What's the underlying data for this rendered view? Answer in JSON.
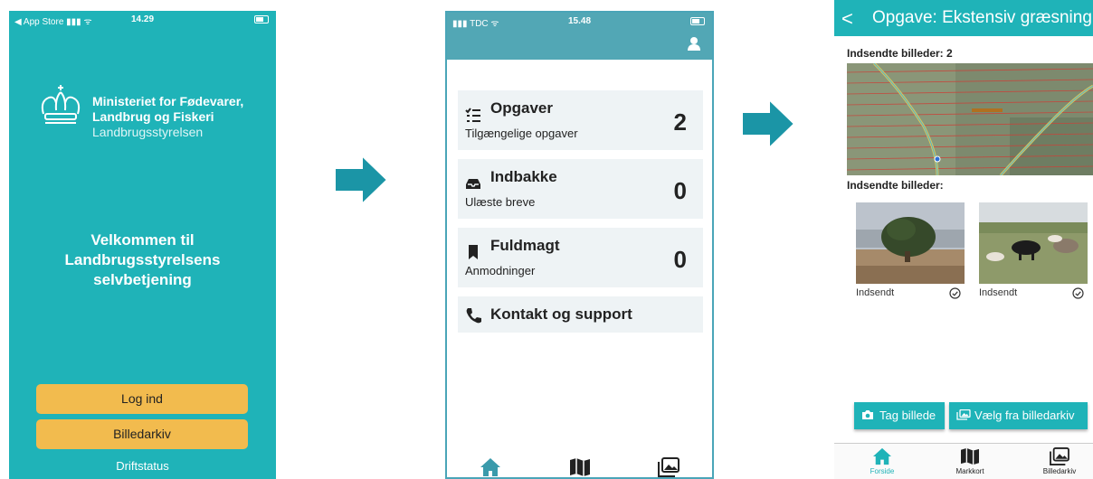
{
  "colors": {
    "teal": "#1fb3b8",
    "teal_header": "#52a7b5",
    "yellow_button": "#f2bb4e",
    "arrow": "#1b95a6",
    "card_bg": "#eef3f5"
  },
  "screen1": {
    "status": {
      "left": "◀ App Store ▮▮▮ ᯤ",
      "time": "14.29"
    },
    "ministry_line1": "Ministeriet for Fødevarer,",
    "ministry_line2": "Landbrug og Fiskeri",
    "ministry_line3": "Landbrugsstyrelsen",
    "welcome_line1": "Velkommen til",
    "welcome_line2": "Landbrugsstyrelsens",
    "welcome_line3": "selvbetjening",
    "login_label": "Log ind",
    "archive_label": "Billedarkiv",
    "status_link": "Driftstatus"
  },
  "screen2": {
    "status": {
      "left": "▮▮▮ TDC ᯤ",
      "time": "15.48"
    },
    "cards": [
      {
        "title": "Opgaver",
        "subtitle": "Tilgængelige opgaver",
        "count": "2",
        "icon": "list-icon"
      },
      {
        "title": "Indbakke",
        "subtitle": "Ulæste breve",
        "count": "0",
        "icon": "inbox-icon"
      },
      {
        "title": "Fuldmagt",
        "subtitle": "Anmodninger",
        "count": "0",
        "icon": "bookmark-icon"
      },
      {
        "title": "Kontakt og support",
        "icon": "phone-icon"
      }
    ],
    "bottom_nav_icons": [
      "home-icon",
      "map-icon",
      "gallery-icon"
    ]
  },
  "screen3": {
    "back": "<",
    "title": "Opgave: Ekstensiv græsning",
    "sent_count_label": "Indsendte billeder: 2",
    "sent_label": "Indsendte billeder:",
    "photos": [
      {
        "caption": "Indsendt",
        "subject": "juniper-bush-photo"
      },
      {
        "caption": "Indsendt",
        "subject": "cattle-photo"
      }
    ],
    "take_photo": "Tag billede",
    "choose_archive": "Vælg fra billedarkiv",
    "nav": [
      {
        "label": "Forside",
        "icon": "home-icon",
        "active": true
      },
      {
        "label": "Markkort",
        "icon": "map-icon",
        "active": false
      },
      {
        "label": "Billedarkiv",
        "icon": "gallery-icon",
        "active": false
      }
    ]
  }
}
